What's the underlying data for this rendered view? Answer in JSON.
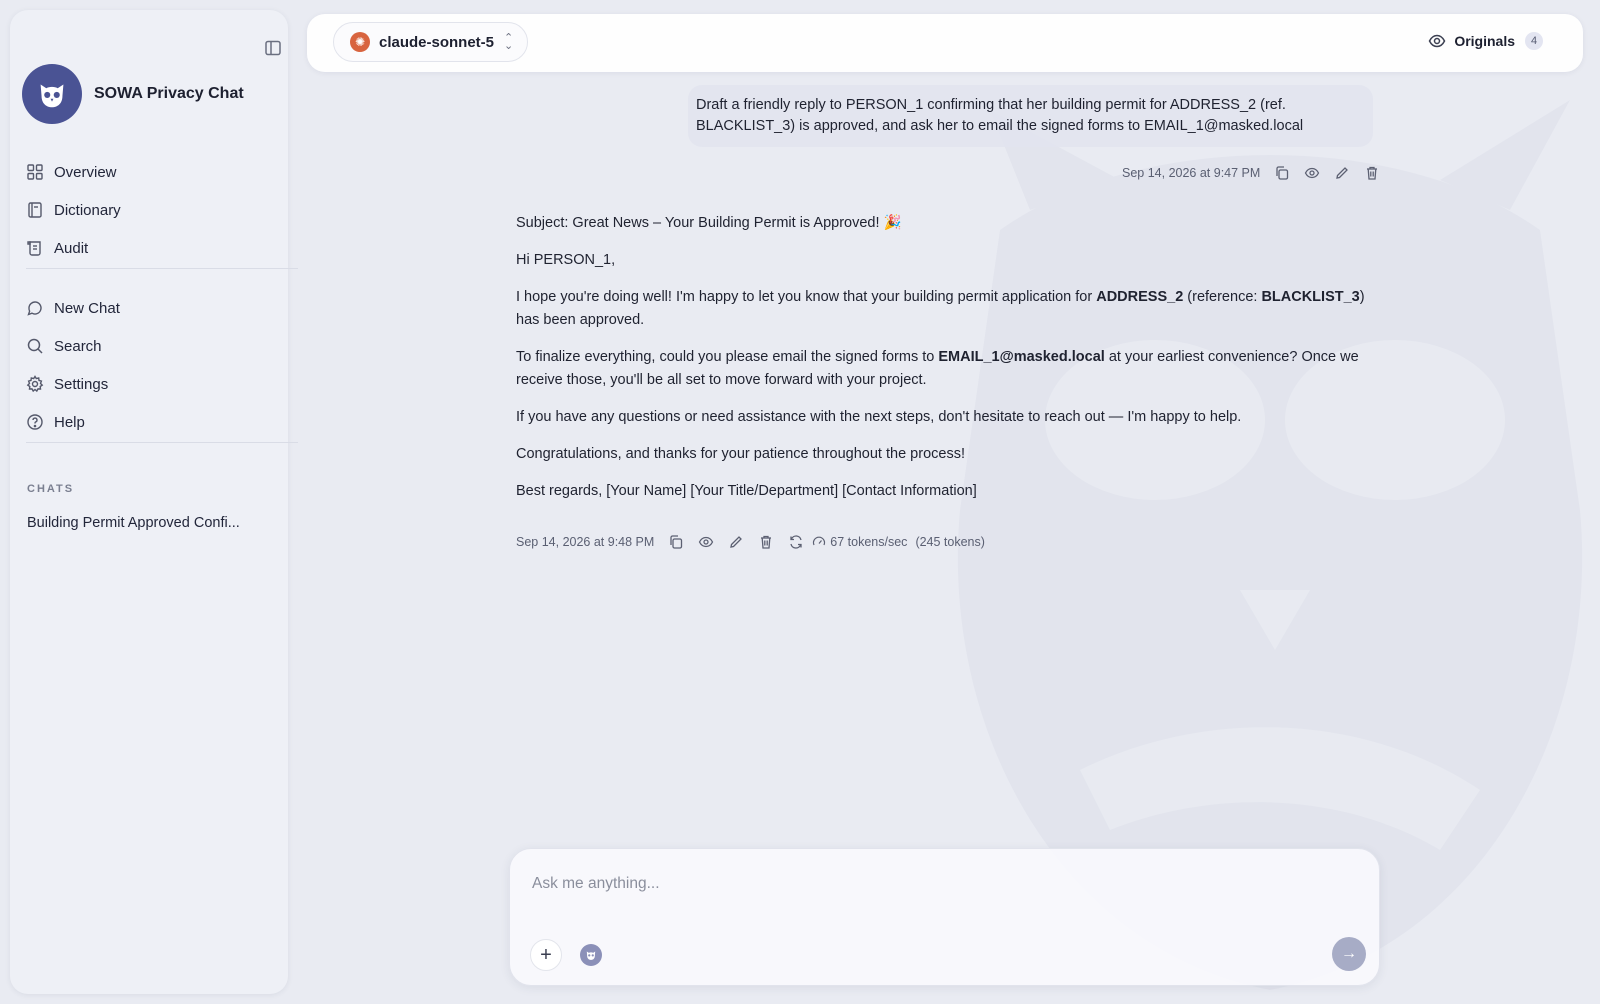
{
  "app": {
    "name": "SOWA Privacy Chat"
  },
  "sidebar": {
    "nav_primary": [
      {
        "label": "Overview",
        "icon": "grid-icon"
      },
      {
        "label": "Dictionary",
        "icon": "book-icon"
      },
      {
        "label": "Audit",
        "icon": "scroll-icon"
      }
    ],
    "nav_secondary": [
      {
        "label": "New Chat",
        "icon": "chat-bubble-icon"
      },
      {
        "label": "Search",
        "icon": "search-icon"
      },
      {
        "label": "Settings",
        "icon": "gear-icon"
      },
      {
        "label": "Help",
        "icon": "help-circle-icon"
      }
    ],
    "chats_heading": "CHATS",
    "chats": [
      {
        "title": "Building Permit Approved Confi..."
      }
    ]
  },
  "topbar": {
    "model": "claude-sonnet-5",
    "originals_label": "Originals",
    "originals_count": "4"
  },
  "conversation": {
    "user_message": {
      "text": "Draft a friendly reply to PERSON_1 confirming that her building permit for ADDRESS_2 (ref. BLACKLIST_3) is approved, and ask her to email the signed forms to EMAIL_1@masked.local",
      "timestamp": "Sep 14, 2026 at 9:47 PM"
    },
    "assistant_message": {
      "subject": "Subject: Great News – Your Building Permit is Approved! 🎉",
      "greeting": "Hi PERSON_1,",
      "p1_a": "I hope you're doing well! I'm happy to let you know that your building permit application for ",
      "p1_address": "ADDRESS_2",
      "p1_b": " (reference: ",
      "p1_ref": "BLACKLIST_3",
      "p1_c": ") has been approved.",
      "p2_a": "To finalize everything, could you please email the signed forms to ",
      "p2_email": "EMAIL_1@masked.local",
      "p2_b": " at your earliest convenience? Once we receive those, you'll be all set to move forward with your project.",
      "p3": "If you have any questions or need assistance with the next steps, don't hesitate to reach out — I'm happy to help.",
      "p4": "Congratulations, and thanks for your patience throughout the process!",
      "p5": "Best regards, [Your Name] [Your Title/Department] [Contact Information]",
      "timestamp": "Sep 14, 2026 at 9:48 PM",
      "speed": "67 tokens/sec",
      "tokens": "(245 tokens)"
    }
  },
  "composer": {
    "placeholder": "Ask me anything..."
  },
  "colors": {
    "background": "#e9ebf2",
    "accent": "#4a5394",
    "model_badge": "#d8643f",
    "send_button": "#a7acc6"
  }
}
